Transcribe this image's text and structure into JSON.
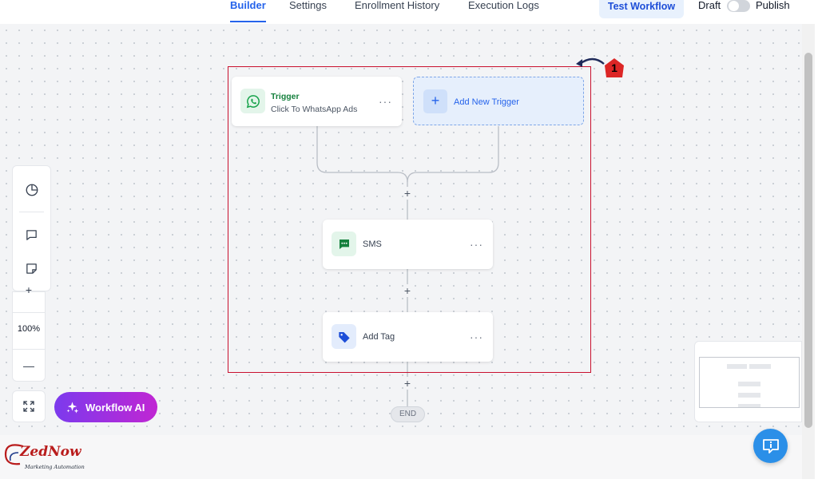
{
  "tabs": [
    {
      "label": "Builder",
      "active": true
    },
    {
      "label": "Settings",
      "active": false
    },
    {
      "label": "Enrollment History",
      "active": false
    },
    {
      "label": "Execution Logs",
      "active": false
    }
  ],
  "header": {
    "test_button": "Test Workflow",
    "draft_label": "Draft",
    "publish_label": "Publish",
    "publish_enabled": false
  },
  "trigger": {
    "title": "Trigger",
    "subtitle": "Click To WhatsApp Ads",
    "icon": "whatsapp-icon"
  },
  "add_trigger": {
    "label": "Add New Trigger",
    "icon": "plus-icon"
  },
  "actions": [
    {
      "label": "SMS",
      "icon": "sms-icon"
    },
    {
      "label": "Add Tag",
      "icon": "tag-icon"
    }
  ],
  "add_step_symbol": "+",
  "more_symbol": "···",
  "end_label": "END",
  "annotation": {
    "step_number": "1"
  },
  "zoom": {
    "level": "100%",
    "in_symbol": "+",
    "out_symbol": "—"
  },
  "workflow_ai": {
    "label": "Workflow AI",
    "icon": "sparkle-icon"
  },
  "logo": {
    "brand": "ZedNow",
    "tagline": "Marketing Automation"
  },
  "colors": {
    "accent": "#2563eb",
    "trigger_green": "#15803d",
    "highlight_red": "#c8102e",
    "ai_gradient_start": "#7c3aed",
    "ai_gradient_end": "#c026d3"
  }
}
